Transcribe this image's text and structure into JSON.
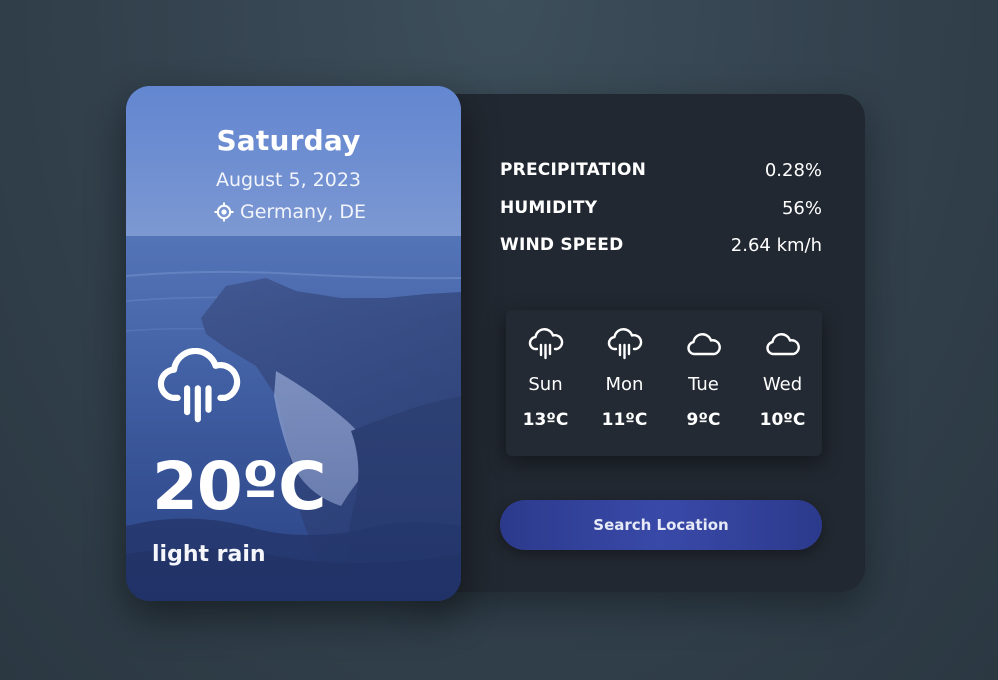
{
  "current": {
    "day": "Saturday",
    "date": "August 5, 2023",
    "location": "Germany, DE",
    "temperature": "20ºC",
    "condition": "light rain",
    "icon": "rain-cloud-icon"
  },
  "details": [
    {
      "label": "PRECIPITATION",
      "value": "0.28%"
    },
    {
      "label": "HUMIDITY",
      "value": "56%"
    },
    {
      "label": "WIND SPEED",
      "value": "2.64 km/h"
    }
  ],
  "forecast": [
    {
      "day": "Sun",
      "temp": "13ºC",
      "icon": "rain-cloud-icon"
    },
    {
      "day": "Mon",
      "temp": "11ºC",
      "icon": "rain-cloud-icon"
    },
    {
      "day": "Tue",
      "temp": "9ºC",
      "icon": "cloud-icon"
    },
    {
      "day": "Wed",
      "temp": "10ºC",
      "icon": "cloud-icon"
    }
  ],
  "search_button": {
    "label": "Search Location"
  },
  "colors": {
    "page_background": "#34434f",
    "panel_background": "#222831",
    "button": "#3949a8",
    "text": "#ffffff"
  }
}
